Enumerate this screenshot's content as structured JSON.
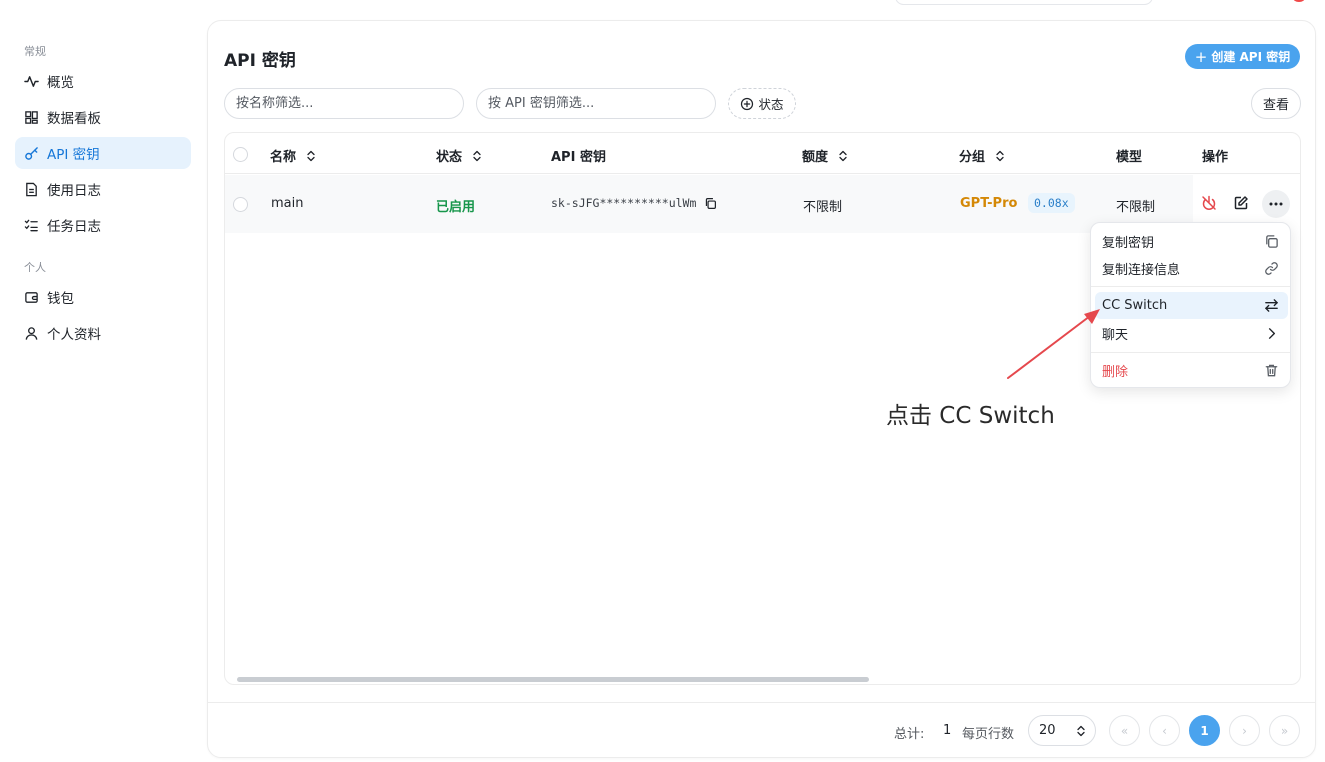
{
  "colors": {
    "accent": "#4aa3ee",
    "active_nav_bg": "#e6f2fd",
    "status_enabled": "#17964b",
    "group_color": "#d48806",
    "danger": "#e5484d",
    "annotation_arrow": "#e5484d"
  },
  "sidebar": {
    "sections": [
      {
        "title": "常规",
        "items": [
          {
            "label": "概览",
            "icon": "activity-icon"
          },
          {
            "label": "数据看板",
            "icon": "dashboard-grid-icon"
          },
          {
            "label": "API 密钥",
            "icon": "key-icon",
            "active": true
          },
          {
            "label": "使用日志",
            "icon": "document-icon"
          },
          {
            "label": "任务日志",
            "icon": "task-list-icon"
          }
        ]
      },
      {
        "title": "个人",
        "items": [
          {
            "label": "钱包",
            "icon": "wallet-icon"
          },
          {
            "label": "个人资料",
            "icon": "user-icon"
          }
        ]
      }
    ]
  },
  "page": {
    "title": "API 密钥",
    "create_button": "创建 API 密钥",
    "filter_name_placeholder": "按名称筛选...",
    "filter_key_placeholder": "按 API 密钥筛选...",
    "status_filter": "状态",
    "view_button": "查看"
  },
  "table": {
    "headers": {
      "name": "名称",
      "status": "状态",
      "api_key": "API 密钥",
      "quota": "额度",
      "group": "分组",
      "model": "模型",
      "actions": "操作"
    },
    "rows": [
      {
        "name": "main",
        "status": "已启用",
        "api_key": "sk-sJFG**********ulWm",
        "quota": "不限制",
        "group": "GPT-Pro",
        "ratio": "0.08x",
        "model": "不限制"
      }
    ]
  },
  "dropdown": {
    "items": {
      "copy_key": "复制密钥",
      "copy_connection": "复制连接信息",
      "cc_switch": "CC Switch",
      "chat": "聊天",
      "delete": "删除"
    }
  },
  "pagination": {
    "total_label": "总计:",
    "total": "1",
    "rows_per_page_label": "每页行数",
    "rows_per_page": "20",
    "current_page": "1"
  },
  "annotation": {
    "text": "点击 CC Switch"
  }
}
